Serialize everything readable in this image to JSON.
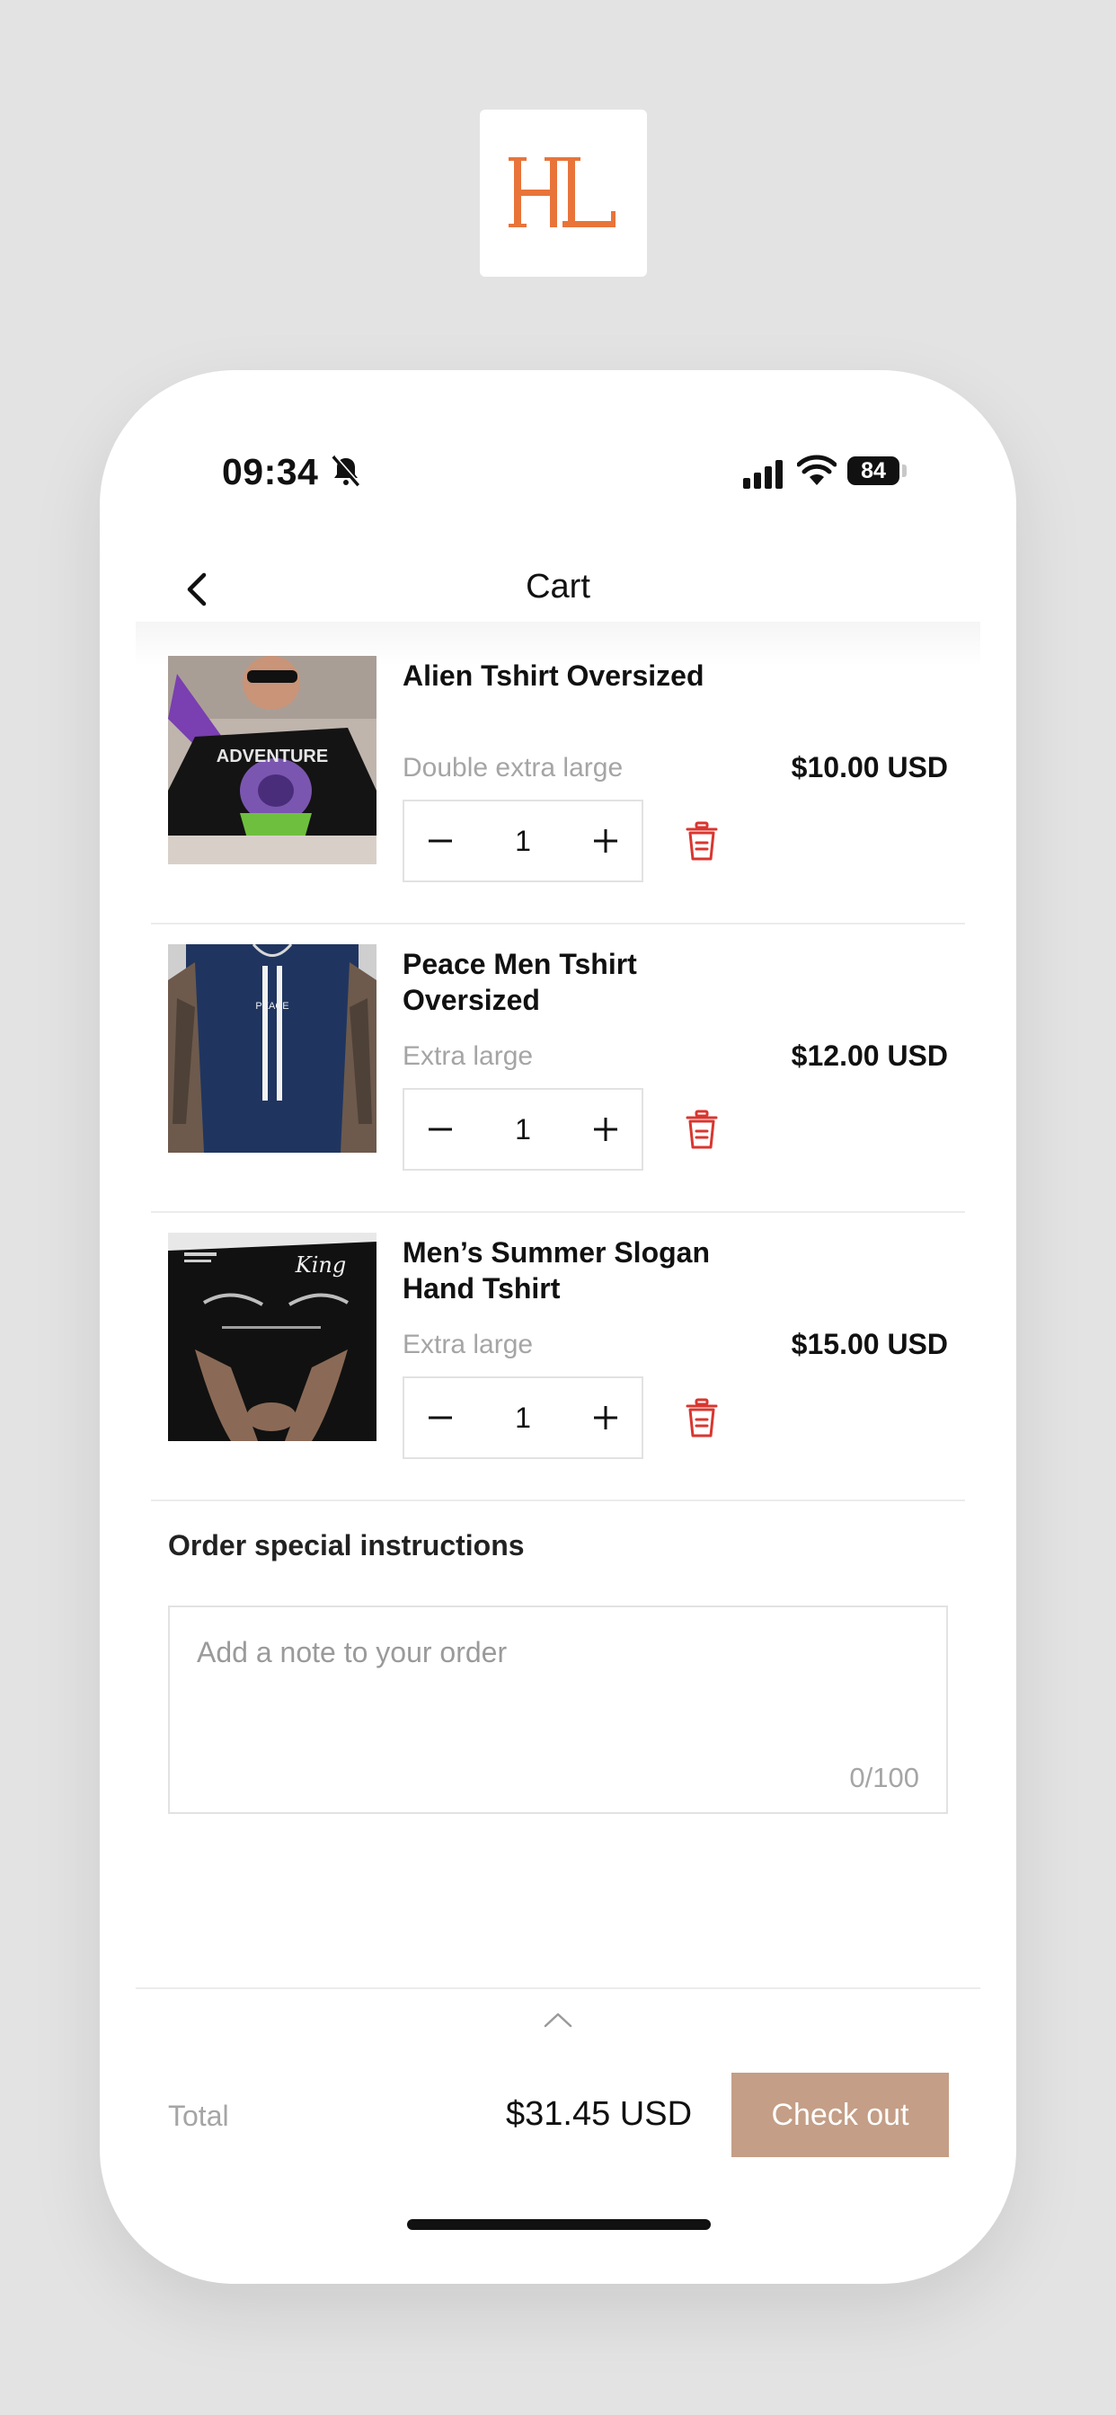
{
  "brand": {
    "logo_text": "HL",
    "logo_color": "#e8743a"
  },
  "status_bar": {
    "time": "09:34",
    "battery": "84"
  },
  "header": {
    "title": "Cart"
  },
  "cart": {
    "items": [
      {
        "title": "Alien Tshirt Oversized",
        "variant": "Double extra large",
        "price": "$10.00 USD",
        "quantity": "1"
      },
      {
        "title": "Peace Men Tshirt Oversized",
        "variant": "Extra large",
        "price": "$12.00 USD",
        "quantity": "1"
      },
      {
        "title": "Men’s Summer Slogan Hand Tshirt",
        "variant": "Extra large",
        "price": "$15.00 USD",
        "quantity": "1"
      }
    ]
  },
  "instructions": {
    "label": "Order special instructions",
    "placeholder": "Add a note to your order",
    "counter": "0/100"
  },
  "footer": {
    "total_label": "Total",
    "total_value": "$31.45 USD",
    "checkout_label": "Check out",
    "checkout_color": "#c49e86"
  },
  "icons": {
    "back": "chevron-left-icon",
    "decrement": "minus-icon",
    "increment": "plus-icon",
    "remove": "trash-icon",
    "expand": "chevron-up-icon"
  }
}
